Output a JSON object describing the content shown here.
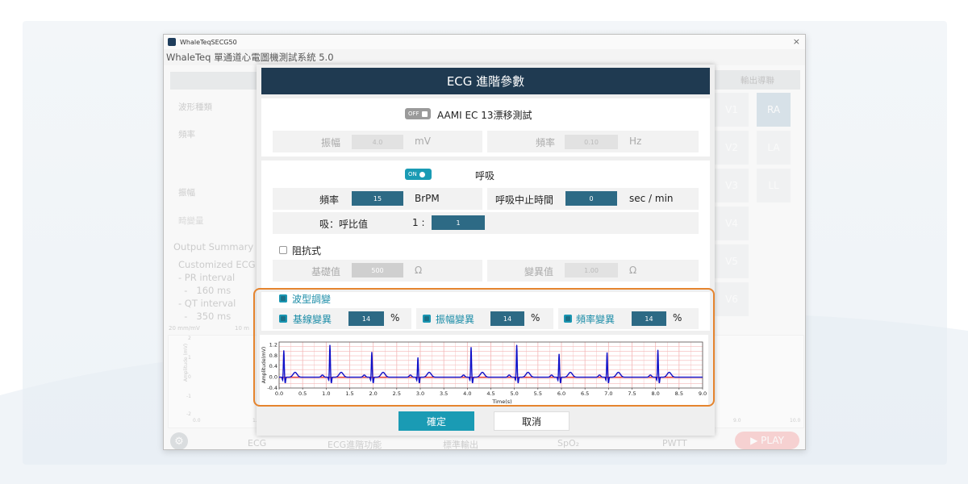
{
  "window": {
    "titlebar": "WhaleTeqSECG50",
    "app_title": "WhaleTeq 單通道心電圖機測試系統 5.0",
    "close": "×"
  },
  "background_app": {
    "left_labels": [
      "波形種類",
      "頻率",
      "振幅",
      "畸變量"
    ],
    "output_summary_title": "Output Summary",
    "summary_lines": [
      "Customized ECG",
      " - PR interval",
      "  -   160 ms",
      " - QT interval",
      "  -   350 ms"
    ],
    "scale_left": "20 mm/mV",
    "scale_right": "10 m",
    "output_leads_title": "輸出導聯",
    "leads_col1": [
      "V1",
      "V2",
      "V3",
      "V4",
      "V5",
      "V6"
    ],
    "leads_col2": [
      "RA",
      "LA",
      "LL"
    ],
    "y_axis_label": "Amplitude (mV)",
    "y_ticks": [
      "2",
      "1",
      "0",
      "-1",
      "-2"
    ],
    "x_ticks_left": [
      "0.0",
      "1.0"
    ],
    "x_ticks_right": [
      "9.0",
      "10.0"
    ],
    "bottom_tabs": [
      "ECG",
      "ECG進階功能",
      "標準輸出",
      "SpO₂",
      "PWTT"
    ],
    "play_label": "▶  PLAY"
  },
  "dialog": {
    "title": "ECG 進階參數",
    "aami": {
      "toggle": "OFF",
      "label": "AAMI EC 13漂移測試",
      "amp_label": "振幅",
      "amp_value": "4.0",
      "amp_unit": "mV",
      "freq_label": "頻率",
      "freq_value": "0.10",
      "freq_unit": "Hz"
    },
    "respiration": {
      "toggle": "ON",
      "label": "呼吸",
      "freq_label": "頻率",
      "freq_value": "15",
      "freq_unit": "BrPM",
      "apnea_label": "呼吸中止時間",
      "apnea_value": "0",
      "apnea_unit": "sec / min",
      "ratio_label": "吸：呼比值",
      "ratio_prefix": "1 :",
      "ratio_value": "1"
    },
    "impedance": {
      "label": "阻抗式",
      "base_label": "基礎值",
      "base_value": "500",
      "base_unit": "Ω",
      "var_label": "變異值",
      "var_value": "1.00",
      "var_unit": "Ω"
    },
    "modulation": {
      "label": "波型調變",
      "baseline_label": "基線變異",
      "baseline_value": "14",
      "amp_label": "振幅變異",
      "amp_value": "14",
      "freq_label": "頻率變異",
      "freq_value": "14",
      "unit": "%"
    },
    "ok_label": "確定",
    "cancel_label": "取消"
  },
  "colors": {
    "header": "#1f3a51",
    "accent": "#1a9bb4",
    "input_on": "#2d6a85",
    "highlight": "#e5842e",
    "ecg": "#1010c8",
    "baseline": "#e02020",
    "grid": "#f4b6b6"
  },
  "chart_data": {
    "type": "line",
    "xlabel": "Time(s)",
    "ylabel": "Amplitude(mV)",
    "xlim": [
      0,
      9
    ],
    "ylim": [
      -0.4,
      1.3
    ],
    "x_ticks": [
      "0.0",
      "0.5",
      "1.0",
      "1.5",
      "2.0",
      "2.5",
      "3.0",
      "3.5",
      "4.0",
      "4.5",
      "5.0",
      "5.5",
      "6.0",
      "6.5",
      "7.0",
      "7.5",
      "8.0",
      "8.5",
      "9.0"
    ],
    "y_ticks": [
      "1.2",
      "0.8",
      "0.4",
      "0.0",
      "-0.4"
    ],
    "beat_times": [
      0.1,
      1.08,
      1.97,
      2.95,
      4.08,
      5.05,
      5.95,
      6.97,
      8.05
    ],
    "beat_peaks": [
      0.98,
      1.18,
      0.92,
      0.72,
      1.1,
      1.18,
      0.85,
      0.9,
      1.0
    ],
    "baseline_value": 0.0
  }
}
